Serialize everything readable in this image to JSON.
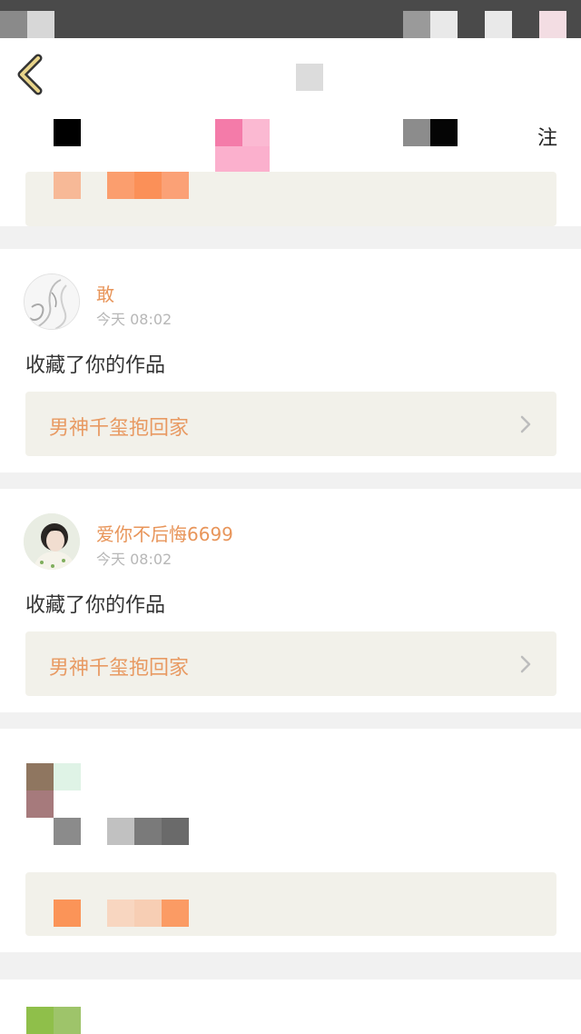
{
  "top_card": {
    "follow_hint": "注"
  },
  "notifications": [
    {
      "user_name": "敢",
      "time": "今天 08:02",
      "action": "收藏了你的作品",
      "work_title": "男神千玺抱回家"
    },
    {
      "user_name": "爱你不后悔6699",
      "time": "今天 08:02",
      "action": "收藏了你的作品",
      "work_title": "男神千玺抱回家"
    }
  ],
  "colors": {
    "accent": "#e8955a",
    "card_ref_bg": "#f2f1ea",
    "page_bg": "#f1f1f1",
    "muted_text": "#b7b7b7"
  },
  "icons": {
    "back": "back-chevron-icon",
    "row_arrow": "chevron-right-icon"
  }
}
